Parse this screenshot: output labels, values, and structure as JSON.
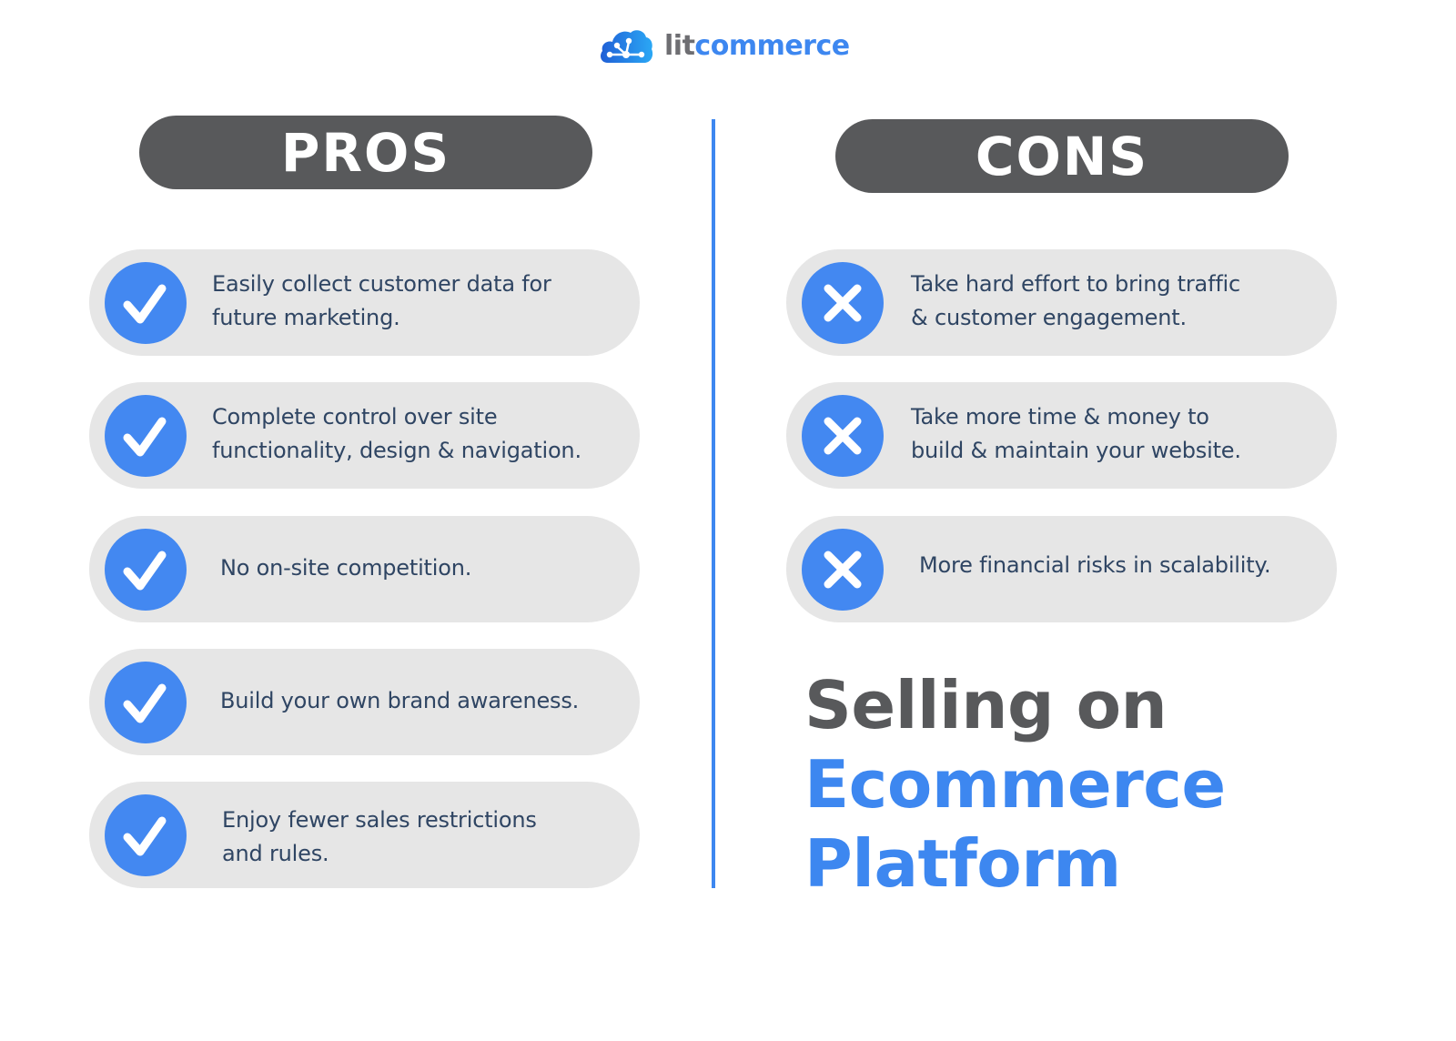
{
  "brand": {
    "logo_icon": "cloud-network-icon",
    "name_part1": "lit",
    "name_part2": "commerce",
    "colors": {
      "primary_blue": "#3d87f0",
      "dark_gray": "#58595b",
      "pill_gray": "#e6e6e6",
      "text_navy": "#2f4563"
    }
  },
  "pros": {
    "title": "PROS",
    "icon": "check-icon",
    "items": [
      {
        "text": "Easily collect customer data for\nfuture marketing."
      },
      {
        "text": "Complete control over site\nfunctionality, design & navigation."
      },
      {
        "text": "No on-site competition."
      },
      {
        "text": "Build your own brand awareness."
      },
      {
        "text": "Enjoy fewer sales restrictions\nand rules."
      }
    ]
  },
  "cons": {
    "title": "CONS",
    "icon": "x-icon",
    "items": [
      {
        "text": "Take hard effort to bring traffic\n& customer engagement."
      },
      {
        "text": "Take more time & money to\nbuild & maintain your website."
      },
      {
        "text": "More financial risks in scalability."
      }
    ]
  },
  "headline": {
    "line1": "Selling on",
    "line2": "Ecommerce",
    "line3": "Platform"
  }
}
